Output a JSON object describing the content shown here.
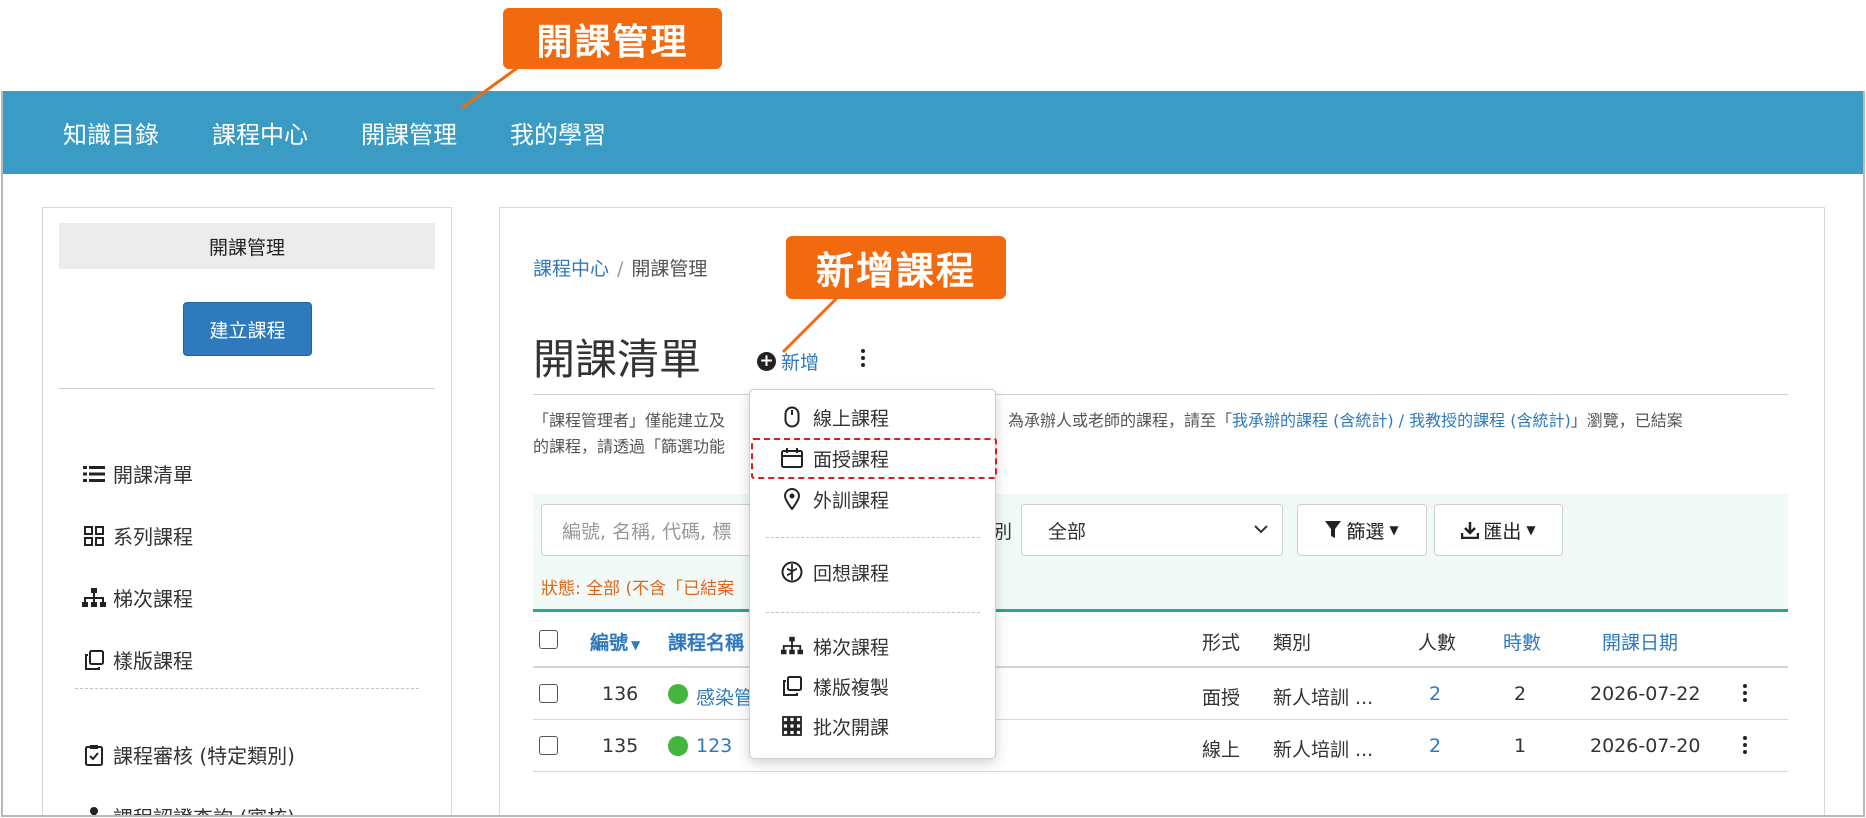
{
  "callouts": {
    "top": "開課管理",
    "new_course": "新增課程"
  },
  "topnav": {
    "items": [
      "知識目錄",
      "課程中心",
      "開課管理",
      "我的學習"
    ],
    "background": "#3a9cc5"
  },
  "sidebar": {
    "title": "開課管理",
    "create_button": "建立課程",
    "items": [
      {
        "label": "開課清單",
        "icon": "list-icon"
      },
      {
        "label": "系列課程",
        "icon": "grid-icon"
      },
      {
        "label": "梯次課程",
        "icon": "sitemap-icon"
      },
      {
        "label": "樣版課程",
        "icon": "copy-icon"
      },
      {
        "label": "課程審核 (特定類別)",
        "icon": "clipboard-check-icon"
      },
      {
        "label": "課程認證查詢 (審核)",
        "icon": "stamp-icon"
      }
    ]
  },
  "breadcrumb": {
    "home": "課程中心",
    "separator": "/",
    "current": "開課管理"
  },
  "page": {
    "title": "開課清單",
    "add_label": "新增"
  },
  "notice": {
    "line1a": "「課程管理者」僅能建立及",
    "line1b": "為承辦人或老師的課程，請至「",
    "link": "我承辦的課程 (含統計) / 我教授的課程 (含統計)",
    "line1c": "」瀏覽，已結案",
    "line2": "的課程，請透過「篩選功能"
  },
  "filters": {
    "search_placeholder": "編號, 名稱, 代碼, 標",
    "category_label": "別",
    "category_value": "全部",
    "filter_button": "篩選",
    "export_button": "匯出",
    "status_line": "狀態: 全部 (不含「已結案"
  },
  "table": {
    "headers": {
      "id": "編號",
      "name": "課程名稱",
      "format": "形式",
      "type": "類別",
      "people": "人數",
      "hours": "時數",
      "date": "開課日期"
    },
    "rows": [
      {
        "id": "136",
        "name": "感染管",
        "format": "面授",
        "type": "新人培訓 ...",
        "people": "2",
        "hours": "2",
        "date": "2026-07-22"
      },
      {
        "id": "135",
        "name": "123",
        "format": "線上",
        "type": "新人培訓 ...",
        "people": "2",
        "hours": "1",
        "date": "2026-07-20"
      }
    ]
  },
  "dropdown": {
    "items": [
      {
        "label": "線上課程",
        "icon": "mouse-icon"
      },
      {
        "label": "面授課程",
        "icon": "calendar-icon",
        "highlighted": true
      },
      {
        "label": "外訓課程",
        "icon": "map-pin-icon"
      },
      {
        "label": "回想課程",
        "icon": "brain-icon"
      },
      {
        "label": "梯次課程",
        "icon": "sitemap-icon"
      },
      {
        "label": "樣版複製",
        "icon": "copy-icon"
      },
      {
        "label": "批次開課",
        "icon": "grid-icon"
      }
    ]
  },
  "colors": {
    "accent": "#f26a10",
    "link": "#2f79bd",
    "status_green": "#44b53d",
    "highlight_border": "#e01b1b"
  }
}
